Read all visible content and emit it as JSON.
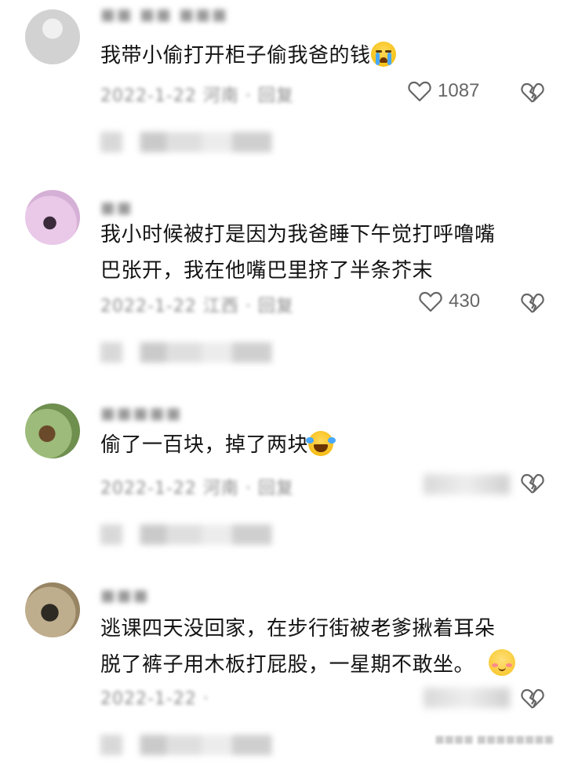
{
  "comments": [
    {
      "text_lines": [
        "我带小偷打开柜子偷我爸的钱"
      ],
      "emoji": "crying-face",
      "likes": "1087",
      "username": "",
      "meta": "",
      "colors": {
        "avatar": "#d9d9d9"
      }
    },
    {
      "text_lines": [
        "我小时候被打是因为我爸睡下午觉打呼噜嘴",
        "巴张开，我在他嘴巴里挤了半条芥末"
      ],
      "emoji": "",
      "likes": "430",
      "username": "",
      "meta": "",
      "colors": {
        "avatar": "#e6c6e6"
      }
    },
    {
      "text_lines": [
        "偷了一百块，掉了两块"
      ],
      "emoji": "laughing-crying-face",
      "likes": "",
      "username": "",
      "meta": "",
      "colors": {
        "avatar": "#8fae6e"
      }
    },
    {
      "text_lines": [
        "逃课四天没回家，在步行街被老爹揪着耳朵",
        "脱了裤子用木板打屁股，一星期不敢坐。"
      ],
      "emoji": "shy-face",
      "likes": "",
      "username": "",
      "meta": "",
      "colors": {
        "avatar": "#a8987a"
      }
    }
  ],
  "icons": {
    "like": "heart-outline-icon",
    "dislike": "broken-heart-icon"
  }
}
